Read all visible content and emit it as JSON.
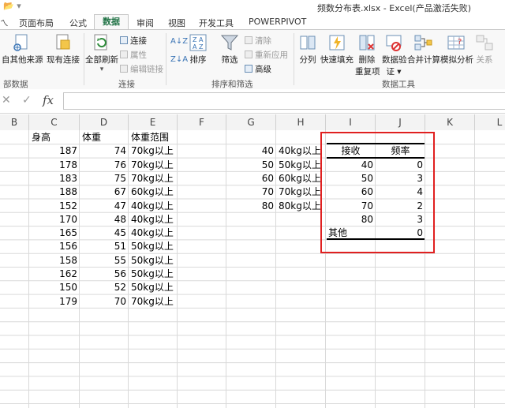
{
  "window": {
    "title": "频数分布表.xlsx - Excel(产品激活失败)"
  },
  "tabs": [
    {
      "label": "页面布局"
    },
    {
      "label": "公式"
    },
    {
      "label": "数据"
    },
    {
      "label": "审阅"
    },
    {
      "label": "视图"
    },
    {
      "label": "开发工具"
    },
    {
      "label": "POWERPIVOT"
    }
  ],
  "ribbon": {
    "groups": {
      "external": "部数据",
      "connections": "连接",
      "sortfilter": "排序和筛选",
      "datatools": "数据工具"
    },
    "btn": {
      "from_other": "自其他来源",
      "existing": "现有连接",
      "refresh_all": "全部刷新",
      "connections": "连接",
      "properties": "属性",
      "edit_links": "编辑链接",
      "sort": "排序",
      "filter": "筛选",
      "clear": "清除",
      "reapply": "重新应用",
      "advanced": "高级",
      "split": "分列",
      "flash_fill": "快速填充",
      "remove_dup_1": "删除",
      "remove_dup_2": "重复项",
      "validation_1": "数据验",
      "validation_2": "证 ▾",
      "consolidate": "合并计算",
      "whatif": "模拟分析",
      "relations": "关系"
    }
  },
  "formula_bar": {
    "fx": "fx",
    "value": ""
  },
  "columns": [
    "B",
    "C",
    "D",
    "E",
    "F",
    "G",
    "H",
    "I",
    "J",
    "K",
    "L"
  ],
  "sheet": {
    "headers": {
      "height": "身高",
      "weight": "体重",
      "range": "体重范围"
    },
    "rows": [
      {
        "h": "187",
        "w": "74",
        "r": "70kg以上"
      },
      {
        "h": "178",
        "w": "76",
        "r": "70kg以上"
      },
      {
        "h": "183",
        "w": "75",
        "r": "70kg以上"
      },
      {
        "h": "188",
        "w": "67",
        "r": "60kg以上"
      },
      {
        "h": "152",
        "w": "47",
        "r": "40kg以上"
      },
      {
        "h": "170",
        "w": "48",
        "r": "40kg以上"
      },
      {
        "h": "165",
        "w": "45",
        "r": "40kg以上"
      },
      {
        "h": "156",
        "w": "51",
        "r": "50kg以上"
      },
      {
        "h": "158",
        "w": "55",
        "r": "50kg以上"
      },
      {
        "h": "162",
        "w": "56",
        "r": "50kg以上"
      },
      {
        "h": "150",
        "w": "52",
        "r": "50kg以上"
      },
      {
        "h": "179",
        "w": "70",
        "r": "70kg以上"
      }
    ],
    "bins": [
      {
        "v": "40",
        "l": "40kg以上"
      },
      {
        "v": "50",
        "l": "50kg以上"
      },
      {
        "v": "60",
        "l": "60kg以上"
      },
      {
        "v": "70",
        "l": "70kg以上"
      },
      {
        "v": "80",
        "l": "80kg以上"
      }
    ],
    "freq_table": {
      "header_bin": "接收",
      "header_freq": "频率",
      "rows": [
        {
          "bin": "40",
          "freq": "0"
        },
        {
          "bin": "50",
          "freq": "3"
        },
        {
          "bin": "60",
          "freq": "4"
        },
        {
          "bin": "70",
          "freq": "2"
        },
        {
          "bin": "80",
          "freq": "3"
        },
        {
          "bin": "其他",
          "freq": "0"
        }
      ]
    },
    "highlight_color": "#e02020"
  }
}
